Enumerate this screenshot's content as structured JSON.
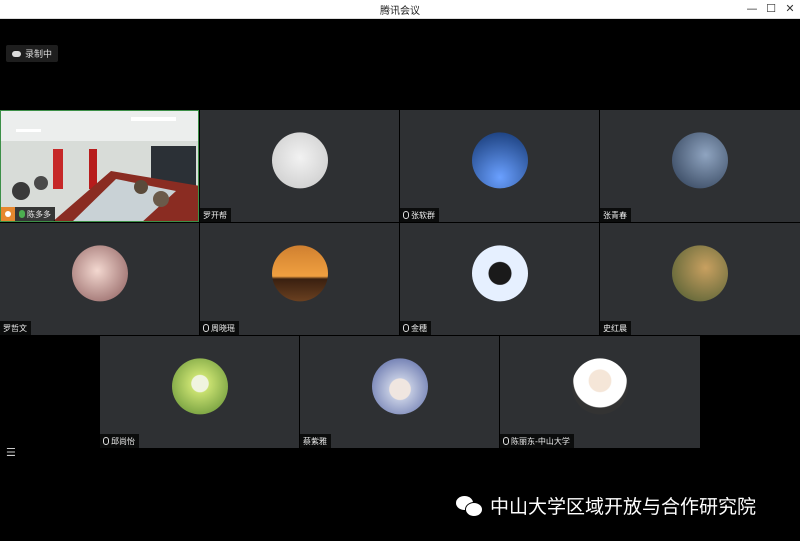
{
  "window": {
    "title": "腾讯会议",
    "minimize": "—",
    "maximize": "☐",
    "close": "✕"
  },
  "recording": {
    "label": "录制中"
  },
  "participants": [
    {
      "name": "陈多多",
      "host": true,
      "mic": "active",
      "video": true
    },
    {
      "name": "罗开帮",
      "mic": "none",
      "avatar_colors": [
        "#f2f2f2",
        "#c8c8c8"
      ]
    },
    {
      "name": "张软群",
      "mic": "muted",
      "avatar_colors": [
        "#6aa0ff",
        "#12346e"
      ]
    },
    {
      "name": "张青春",
      "mic": "none",
      "avatar_colors": [
        "#8fa4c0",
        "#2a3a52"
      ]
    },
    {
      "name": "罗哲文",
      "mic": "none",
      "avatar_colors": [
        "#f3d8d0",
        "#8a5a5a"
      ]
    },
    {
      "name": "周晓瑶",
      "mic": "muted",
      "avatar_colors": [
        "#f0a040",
        "#3a2010"
      ]
    },
    {
      "name": "金穗",
      "mic": "muted",
      "avatar_colors": [
        "#e6f0ff",
        "#1a1a1a"
      ]
    },
    {
      "name": "史红晨",
      "mic": "none",
      "avatar_colors": [
        "#c8a060",
        "#4a5a30"
      ]
    },
    {
      "name": "邱尚怡",
      "mic": "muted",
      "avatar_colors": [
        "#c8e070",
        "#5a8a30"
      ]
    },
    {
      "name": "蔡紫雅",
      "mic": "none",
      "avatar_colors": [
        "#c0c8e0",
        "#5060a0"
      ]
    },
    {
      "name": "陈丽东-中山大学",
      "mic": "muted",
      "avatar_colors": [
        "#ffffff",
        "#333333"
      ]
    }
  ],
  "participant_list_icon": "☰",
  "watermark": {
    "text": "中山大学区域开放与合作研究院"
  }
}
